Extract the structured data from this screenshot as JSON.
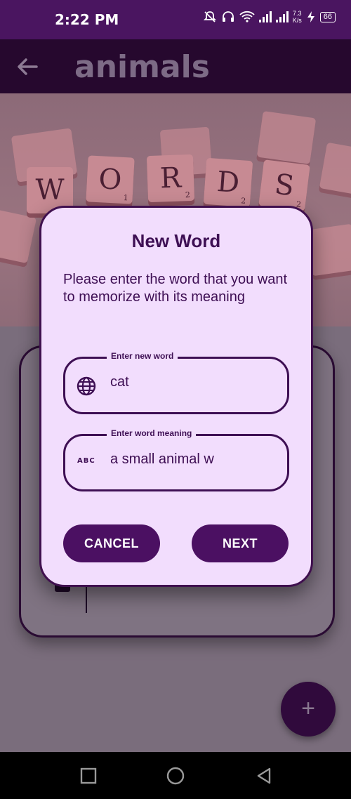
{
  "status_bar": {
    "time": "2:22 PM",
    "net_speed_value": "7.3",
    "net_speed_unit": "K/s",
    "battery": "66",
    "icons": [
      "mute-icon",
      "headset-icon",
      "wifi-icon",
      "signal-icon",
      "signal-icon",
      "charging-icon",
      "battery-icon"
    ]
  },
  "app_bar": {
    "title": "animals",
    "back_icon": "arrow-left-icon"
  },
  "hero": {
    "tiles": [
      {
        "letter": "W",
        "sub": ""
      },
      {
        "letter": "O",
        "sub": "1"
      },
      {
        "letter": "R",
        "sub": "2"
      },
      {
        "letter": "D",
        "sub": "2"
      },
      {
        "letter": "S",
        "sub": "2"
      }
    ]
  },
  "dialog": {
    "title": "New Word",
    "message": "Please enter the word that you want to memorize with its meaning",
    "word_field": {
      "label": "Enter new word",
      "value": "cat",
      "icon": "globe-icon"
    },
    "meaning_field": {
      "label": "Enter word meaning",
      "value": "a small animal w",
      "icon": "abc-icon",
      "icon_text": "ABC"
    },
    "cancel_label": "CANCEL",
    "next_label": "NEXT"
  },
  "fab": {
    "label": "+"
  },
  "colors": {
    "primary": "#4b1062",
    "dialog_bg": "#f2ddfd",
    "text": "#3e0f54",
    "status_bar": "#4a1560"
  }
}
